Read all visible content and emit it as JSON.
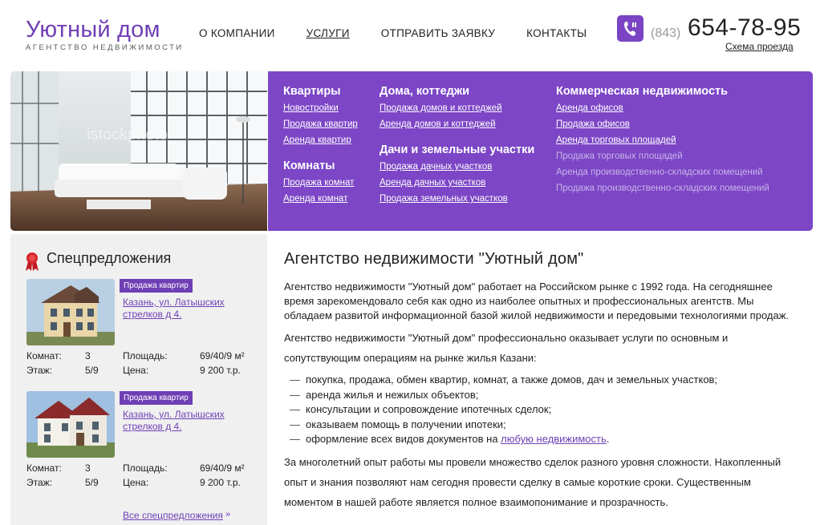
{
  "header": {
    "logo_title": "Уютный дом",
    "logo_subtitle": "АГЕНТСТВО НЕДВИЖИМОСТИ",
    "nav": [
      "О КОМПАНИИ",
      "УСЛУГИ",
      "ОТПРАВИТЬ ЗАЯВКУ",
      "КОНТАКТЫ"
    ],
    "active_nav": "УСЛУГИ",
    "phone_code": "(843)",
    "phone_number": "654-78-95",
    "route_link": "Схема проезда",
    "accent_color": "#7c46c6"
  },
  "menu": {
    "col1": {
      "heading": "Квартиры",
      "links": [
        "Новостройки",
        "Продажа квартир",
        "Аренда квартир"
      ],
      "heading2": "Комнаты",
      "links2": [
        "Продажа комнат",
        "Аренда комнат"
      ]
    },
    "col2": {
      "heading": "Дома, коттеджи",
      "links": [
        "Продажа домов и коттеджей",
        "Аренда домов и коттеджей"
      ],
      "heading2": "Дачи и земельные участки",
      "links2": [
        "Продажа дачных участков",
        "Аренда дачных участков",
        "Продажа земельных участков"
      ]
    },
    "col3": {
      "heading": "Коммерческая недвижимость",
      "links": [
        "Аренда офисов",
        "Продажа офисов",
        "Аренда торговых площадей"
      ],
      "dim_links": [
        "Продажа торговых площадей",
        "Аренда производственно-складских помещений",
        "Продажа производственно-складских помещений"
      ]
    }
  },
  "sidebar": {
    "title": "Спецпредложения",
    "offers": [
      {
        "badge": "Продажа квартир",
        "address": "Казань, ул. Латышских стрелков д 4.",
        "rooms_label": "Комнат:",
        "rooms": "3",
        "floor_label": "Этаж:",
        "floor": "5/9",
        "area_label": "Площадь:",
        "area": "69/40/9 м²",
        "price_label": "Цена:",
        "price": "9 200 т.р."
      },
      {
        "badge": "Продажа квартир",
        "address": "Казань, ул. Латышских стрелков д 4.",
        "rooms_label": "Комнат:",
        "rooms": "3",
        "floor_label": "Этаж:",
        "floor": "5/9",
        "area_label": "Площадь:",
        "area": "69/40/9 м²",
        "price_label": "Цена:",
        "price": "9 200 т.р."
      }
    ],
    "all_offers": "Все спецпредложения",
    "all_arrow": "»"
  },
  "main": {
    "title": "Агентство недвижимости \"Уютный дом\"",
    "p1": "Агентство недвижимости \"Уютный дом\" работает на Российском рынке с 1992 года. На сегодняшнее время зарекомендовало себя как одно из наиболее опытных и профессиональных агентств. Мы обладаем развитой информационной базой жилой недвижимости и передовыми технологиями продаж.",
    "p2": "Агентство недвижимости \"Уютный дом\" профессионально оказывает услуги по основным и сопутствующим операциям на рынке жилья Казани:",
    "list": [
      "покупка, продажа, обмен квартир, комнат, а также домов, дач и земельных участков;",
      "аренда жилья и нежилых объектов;",
      "консультации и сопровождение ипотечных сделок;",
      "оказываем помощь в получении ипотеки;"
    ],
    "list_last_prefix": "оформление всех видов документов на ",
    "list_last_link": "любую недвижимость",
    "list_last_suffix": ".",
    "p3": "За многолетний опыт работы мы провели множество сделок разного уровня сложности. Накопленный опыт и знания позволяют нам сегодня провести сделку в самые короткие сроки. Существенным моментом в нашей работе является полное взаимопонимание и прозрачность."
  }
}
